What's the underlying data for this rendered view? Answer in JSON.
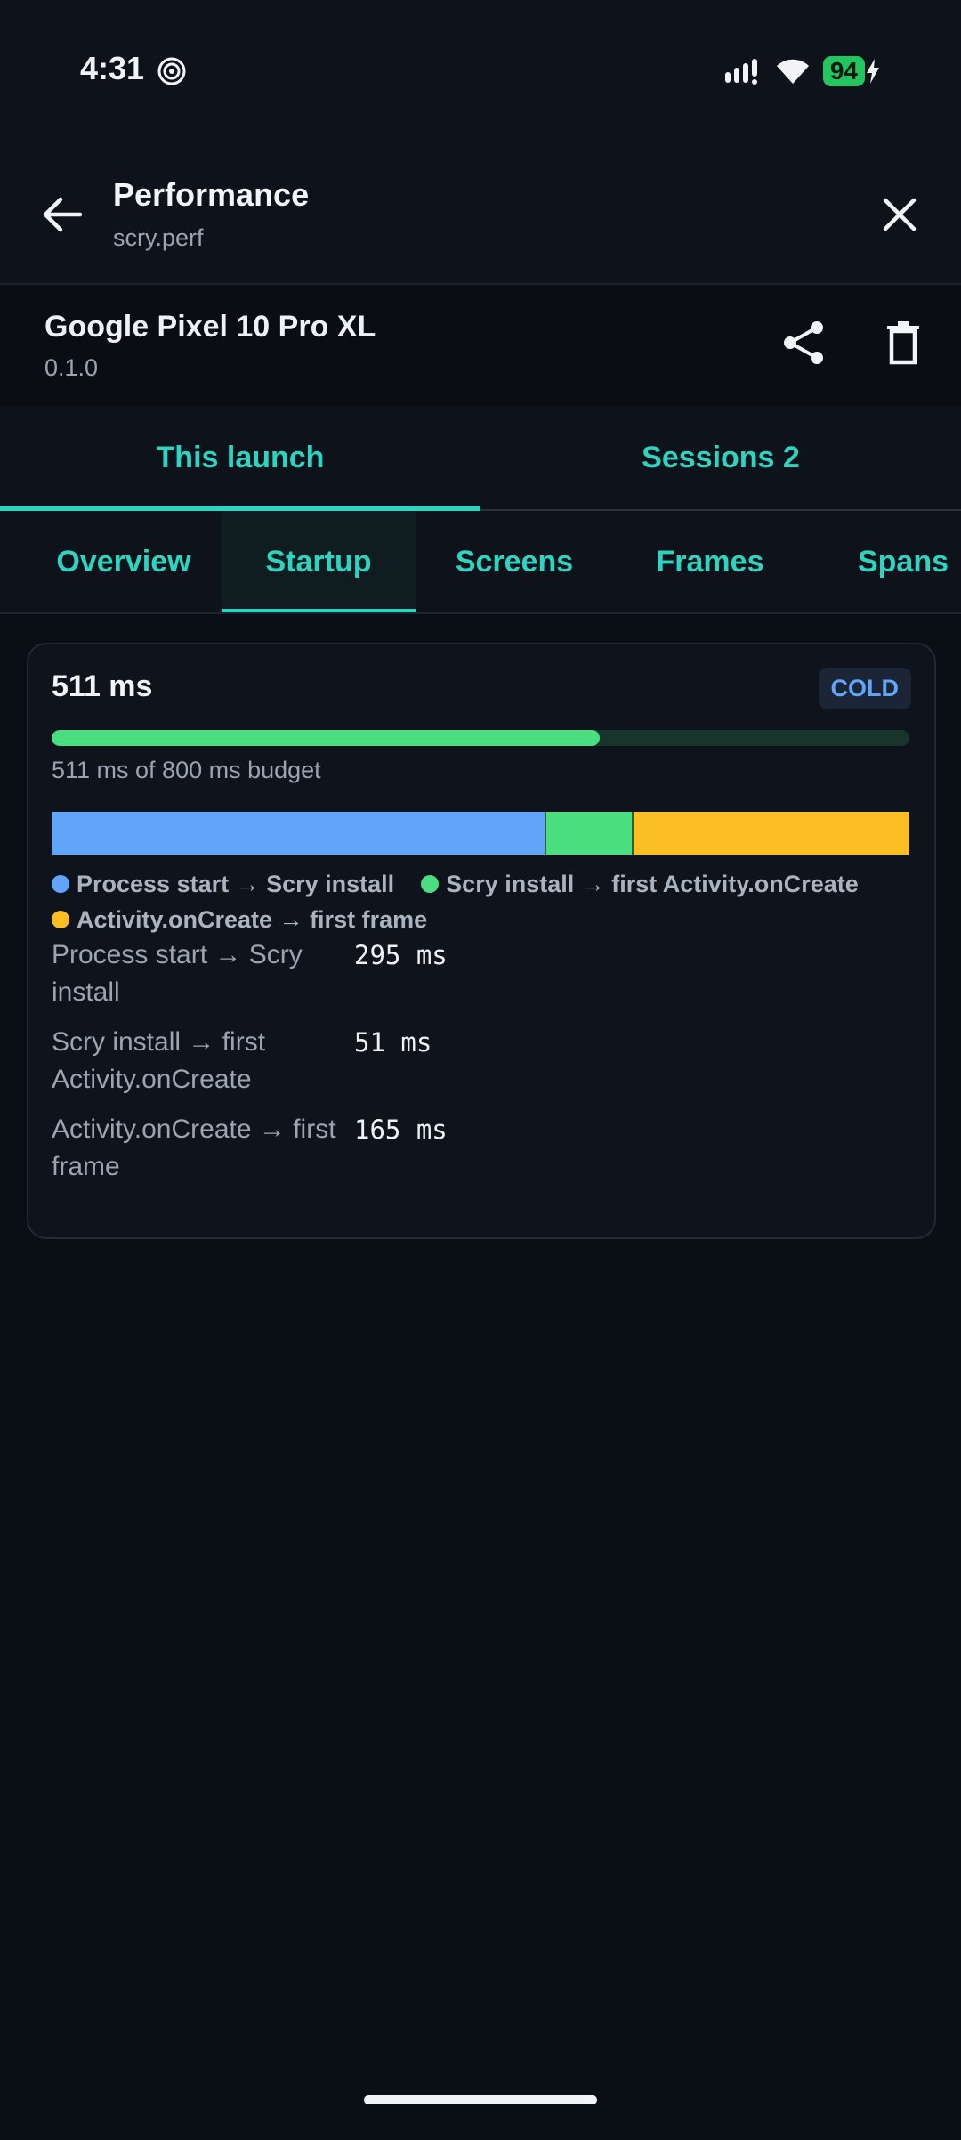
{
  "status_bar": {
    "time": "4:31",
    "battery_level": "94",
    "icons": [
      "spiral-icon",
      "signal-icon",
      "wifi-icon",
      "battery-icon",
      "charging-bolt-icon"
    ]
  },
  "header": {
    "title": "Performance",
    "subtitle": "scry.perf",
    "icons": [
      "back-arrow-icon",
      "close-icon"
    ]
  },
  "device": {
    "name": "Google Pixel 10 Pro XL",
    "version": "0.1.0",
    "icons": [
      "share-icon",
      "trash-icon"
    ]
  },
  "top_tabs": [
    {
      "label": "This launch",
      "active": true
    },
    {
      "label": "Sessions 2",
      "active": false
    }
  ],
  "sub_tabs": [
    {
      "label": "Overview",
      "active": false
    },
    {
      "label": "Startup",
      "active": true
    },
    {
      "label": "Screens",
      "active": false
    },
    {
      "label": "Frames",
      "active": false
    },
    {
      "label": "Spans",
      "active": false
    }
  ],
  "startup_card": {
    "total": "511 ms",
    "badge": "COLD",
    "budget_text": "511 ms of 800 ms budget",
    "budget_fraction": 0.639,
    "phases": [
      {
        "name": "Process start → Scry install",
        "label": "Process start → Scry install",
        "value_ms": 295,
        "value_text": "295 ms",
        "color": "#60a5fa"
      },
      {
        "name": "Scry install → first Activity.onCreate",
        "label": "Scry install → first Activity.onCreate",
        "value_ms": 51,
        "value_text": "51 ms",
        "color": "#4ade80"
      },
      {
        "name": "Activity.onCreate → first frame",
        "label": "Activity.onCreate → first frame",
        "value_ms": 165,
        "value_text": "165 ms",
        "color": "#fbbf24"
      }
    ]
  },
  "colors": {
    "accent": "#2dd4bf",
    "background": "#0a0e15",
    "budget_fill": "#4ade80",
    "badge_text": "#60a5fa"
  }
}
